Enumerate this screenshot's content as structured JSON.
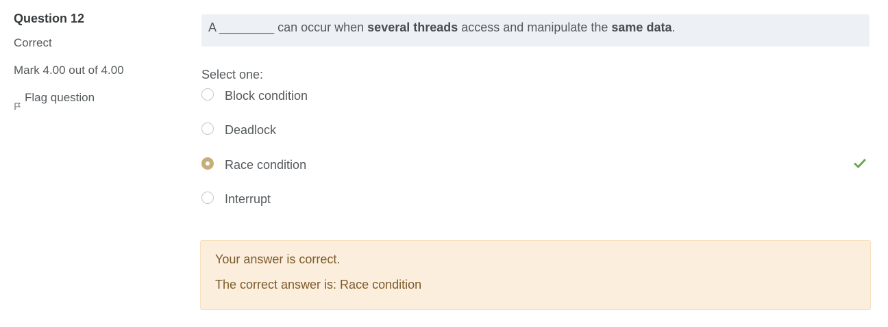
{
  "question_info": {
    "question_word": "Question",
    "number": "12",
    "state": "Correct",
    "grade": "Mark 4.00 out of 4.00",
    "flag_label": "Flag question",
    "flag_icon": "flag-icon"
  },
  "question": {
    "text_start": "A ________ can occur when ",
    "bold1": "several threads",
    "text_mid": " access and manipulate the ",
    "bold2": "same data",
    "text_end": ".",
    "prompt": "Select one:",
    "options": [
      {
        "label": "Block condition",
        "selected": false
      },
      {
        "label": "Deadlock",
        "selected": false
      },
      {
        "label": "Race condition",
        "selected": true,
        "mark": "check-icon"
      },
      {
        "label": "Interrupt",
        "selected": false
      }
    ]
  },
  "feedback": {
    "result": "Your answer is correct.",
    "right_answer": "The correct answer is: Race condition"
  },
  "colors": {
    "accent_radio": "#c6ae78",
    "correct_check": "#6aa84f",
    "feedback_bg": "#fbeedd",
    "feedback_text": "#7d5a29",
    "question_bg": "#edf1f5"
  }
}
